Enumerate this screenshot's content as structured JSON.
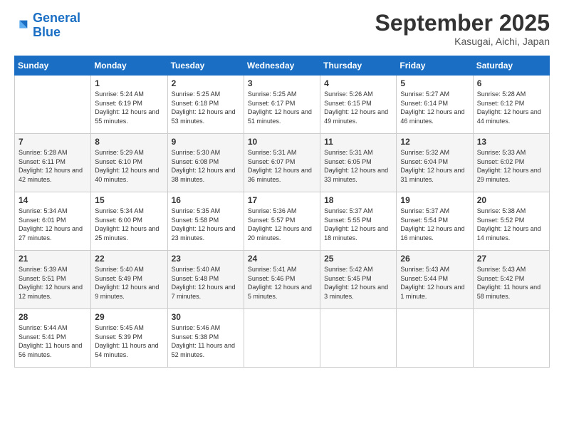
{
  "logo": {
    "text_general": "General",
    "text_blue": "Blue"
  },
  "header": {
    "month": "September 2025",
    "location": "Kasugai, Aichi, Japan"
  },
  "weekdays": [
    "Sunday",
    "Monday",
    "Tuesday",
    "Wednesday",
    "Thursday",
    "Friday",
    "Saturday"
  ],
  "weeks": [
    [
      {
        "day": "",
        "sunrise": "",
        "sunset": "",
        "daylight": ""
      },
      {
        "day": "1",
        "sunrise": "Sunrise: 5:24 AM",
        "sunset": "Sunset: 6:19 PM",
        "daylight": "Daylight: 12 hours and 55 minutes."
      },
      {
        "day": "2",
        "sunrise": "Sunrise: 5:25 AM",
        "sunset": "Sunset: 6:18 PM",
        "daylight": "Daylight: 12 hours and 53 minutes."
      },
      {
        "day": "3",
        "sunrise": "Sunrise: 5:25 AM",
        "sunset": "Sunset: 6:17 PM",
        "daylight": "Daylight: 12 hours and 51 minutes."
      },
      {
        "day": "4",
        "sunrise": "Sunrise: 5:26 AM",
        "sunset": "Sunset: 6:15 PM",
        "daylight": "Daylight: 12 hours and 49 minutes."
      },
      {
        "day": "5",
        "sunrise": "Sunrise: 5:27 AM",
        "sunset": "Sunset: 6:14 PM",
        "daylight": "Daylight: 12 hours and 46 minutes."
      },
      {
        "day": "6",
        "sunrise": "Sunrise: 5:28 AM",
        "sunset": "Sunset: 6:12 PM",
        "daylight": "Daylight: 12 hours and 44 minutes."
      }
    ],
    [
      {
        "day": "7",
        "sunrise": "Sunrise: 5:28 AM",
        "sunset": "Sunset: 6:11 PM",
        "daylight": "Daylight: 12 hours and 42 minutes."
      },
      {
        "day": "8",
        "sunrise": "Sunrise: 5:29 AM",
        "sunset": "Sunset: 6:10 PM",
        "daylight": "Daylight: 12 hours and 40 minutes."
      },
      {
        "day": "9",
        "sunrise": "Sunrise: 5:30 AM",
        "sunset": "Sunset: 6:08 PM",
        "daylight": "Daylight: 12 hours and 38 minutes."
      },
      {
        "day": "10",
        "sunrise": "Sunrise: 5:31 AM",
        "sunset": "Sunset: 6:07 PM",
        "daylight": "Daylight: 12 hours and 36 minutes."
      },
      {
        "day": "11",
        "sunrise": "Sunrise: 5:31 AM",
        "sunset": "Sunset: 6:05 PM",
        "daylight": "Daylight: 12 hours and 33 minutes."
      },
      {
        "day": "12",
        "sunrise": "Sunrise: 5:32 AM",
        "sunset": "Sunset: 6:04 PM",
        "daylight": "Daylight: 12 hours and 31 minutes."
      },
      {
        "day": "13",
        "sunrise": "Sunrise: 5:33 AM",
        "sunset": "Sunset: 6:02 PM",
        "daylight": "Daylight: 12 hours and 29 minutes."
      }
    ],
    [
      {
        "day": "14",
        "sunrise": "Sunrise: 5:34 AM",
        "sunset": "Sunset: 6:01 PM",
        "daylight": "Daylight: 12 hours and 27 minutes."
      },
      {
        "day": "15",
        "sunrise": "Sunrise: 5:34 AM",
        "sunset": "Sunset: 6:00 PM",
        "daylight": "Daylight: 12 hours and 25 minutes."
      },
      {
        "day": "16",
        "sunrise": "Sunrise: 5:35 AM",
        "sunset": "Sunset: 5:58 PM",
        "daylight": "Daylight: 12 hours and 23 minutes."
      },
      {
        "day": "17",
        "sunrise": "Sunrise: 5:36 AM",
        "sunset": "Sunset: 5:57 PM",
        "daylight": "Daylight: 12 hours and 20 minutes."
      },
      {
        "day": "18",
        "sunrise": "Sunrise: 5:37 AM",
        "sunset": "Sunset: 5:55 PM",
        "daylight": "Daylight: 12 hours and 18 minutes."
      },
      {
        "day": "19",
        "sunrise": "Sunrise: 5:37 AM",
        "sunset": "Sunset: 5:54 PM",
        "daylight": "Daylight: 12 hours and 16 minutes."
      },
      {
        "day": "20",
        "sunrise": "Sunrise: 5:38 AM",
        "sunset": "Sunset: 5:52 PM",
        "daylight": "Daylight: 12 hours and 14 minutes."
      }
    ],
    [
      {
        "day": "21",
        "sunrise": "Sunrise: 5:39 AM",
        "sunset": "Sunset: 5:51 PM",
        "daylight": "Daylight: 12 hours and 12 minutes."
      },
      {
        "day": "22",
        "sunrise": "Sunrise: 5:40 AM",
        "sunset": "Sunset: 5:49 PM",
        "daylight": "Daylight: 12 hours and 9 minutes."
      },
      {
        "day": "23",
        "sunrise": "Sunrise: 5:40 AM",
        "sunset": "Sunset: 5:48 PM",
        "daylight": "Daylight: 12 hours and 7 minutes."
      },
      {
        "day": "24",
        "sunrise": "Sunrise: 5:41 AM",
        "sunset": "Sunset: 5:46 PM",
        "daylight": "Daylight: 12 hours and 5 minutes."
      },
      {
        "day": "25",
        "sunrise": "Sunrise: 5:42 AM",
        "sunset": "Sunset: 5:45 PM",
        "daylight": "Daylight: 12 hours and 3 minutes."
      },
      {
        "day": "26",
        "sunrise": "Sunrise: 5:43 AM",
        "sunset": "Sunset: 5:44 PM",
        "daylight": "Daylight: 12 hours and 1 minute."
      },
      {
        "day": "27",
        "sunrise": "Sunrise: 5:43 AM",
        "sunset": "Sunset: 5:42 PM",
        "daylight": "Daylight: 11 hours and 58 minutes."
      }
    ],
    [
      {
        "day": "28",
        "sunrise": "Sunrise: 5:44 AM",
        "sunset": "Sunset: 5:41 PM",
        "daylight": "Daylight: 11 hours and 56 minutes."
      },
      {
        "day": "29",
        "sunrise": "Sunrise: 5:45 AM",
        "sunset": "Sunset: 5:39 PM",
        "daylight": "Daylight: 11 hours and 54 minutes."
      },
      {
        "day": "30",
        "sunrise": "Sunrise: 5:46 AM",
        "sunset": "Sunset: 5:38 PM",
        "daylight": "Daylight: 11 hours and 52 minutes."
      },
      {
        "day": "",
        "sunrise": "",
        "sunset": "",
        "daylight": ""
      },
      {
        "day": "",
        "sunrise": "",
        "sunset": "",
        "daylight": ""
      },
      {
        "day": "",
        "sunrise": "",
        "sunset": "",
        "daylight": ""
      },
      {
        "day": "",
        "sunrise": "",
        "sunset": "",
        "daylight": ""
      }
    ]
  ]
}
